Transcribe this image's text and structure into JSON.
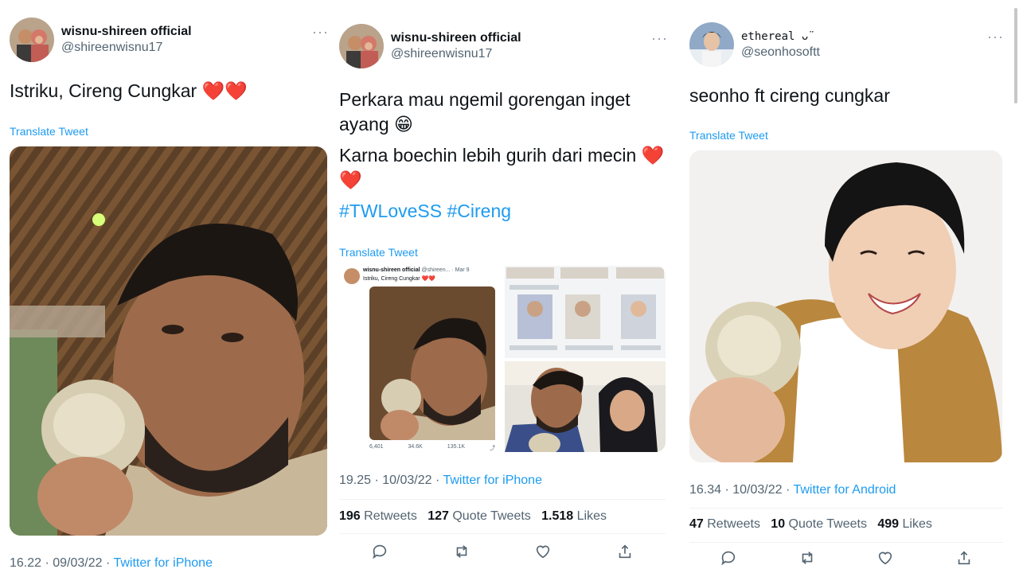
{
  "tweets": [
    {
      "name": "wisnu-shireen official",
      "handle": "@shireenwisnu17",
      "more": "···",
      "text": "Istriku, Cireng Cungkar ❤️❤️",
      "translate": "Translate Tweet",
      "time": "16.22 · 09/03/22 · ",
      "source": "Twitter for iPhone"
    },
    {
      "name": "wisnu-shireen official",
      "handle": "@shireenwisnu17",
      "more": "···",
      "text_line1": "Perkara mau ngemil gorengan inget ayang 😁",
      "text_line2": "Karna boechin lebih gurih dari mecin ❤️❤️",
      "hashtags": "#TWLoveSS #Cireng",
      "translate": "Translate Tweet",
      "time": "19.25 · 10/03/22 · ",
      "source": "Twitter for iPhone",
      "retweets": "196",
      "retweets_label": "Retweets",
      "quotes": "127",
      "quotes_label": "Quote Tweets",
      "likes": "1.518",
      "likes_label": "Likes",
      "embedded": {
        "name": "wisnu-shireen official",
        "handle": "@shireen...",
        "date": "Mar 9",
        "text": "Istriku, Cireng Cungkar ❤️❤️",
        "replies": "6,401",
        "retweets": "34.6K",
        "likes": "135.1K"
      }
    },
    {
      "name": "ethereal ᴗ̈",
      "handle": "@seonhosoftt",
      "more": "···",
      "text": "seonho ft cireng cungkar",
      "translate": "Translate Tweet",
      "time": "16.34 · 10/03/22 · ",
      "source": "Twitter for Android",
      "retweets": "47",
      "retweets_label": "Retweets",
      "quotes": "10",
      "quotes_label": "Quote Tweets",
      "likes": "499",
      "likes_label": "Likes"
    }
  ],
  "colors": {
    "link": "#1d9bf0",
    "secondary": "#536471",
    "primary": "#0f1419"
  },
  "icons": [
    "reply-icon",
    "retweet-icon",
    "like-icon",
    "share-icon",
    "more-icon"
  ]
}
